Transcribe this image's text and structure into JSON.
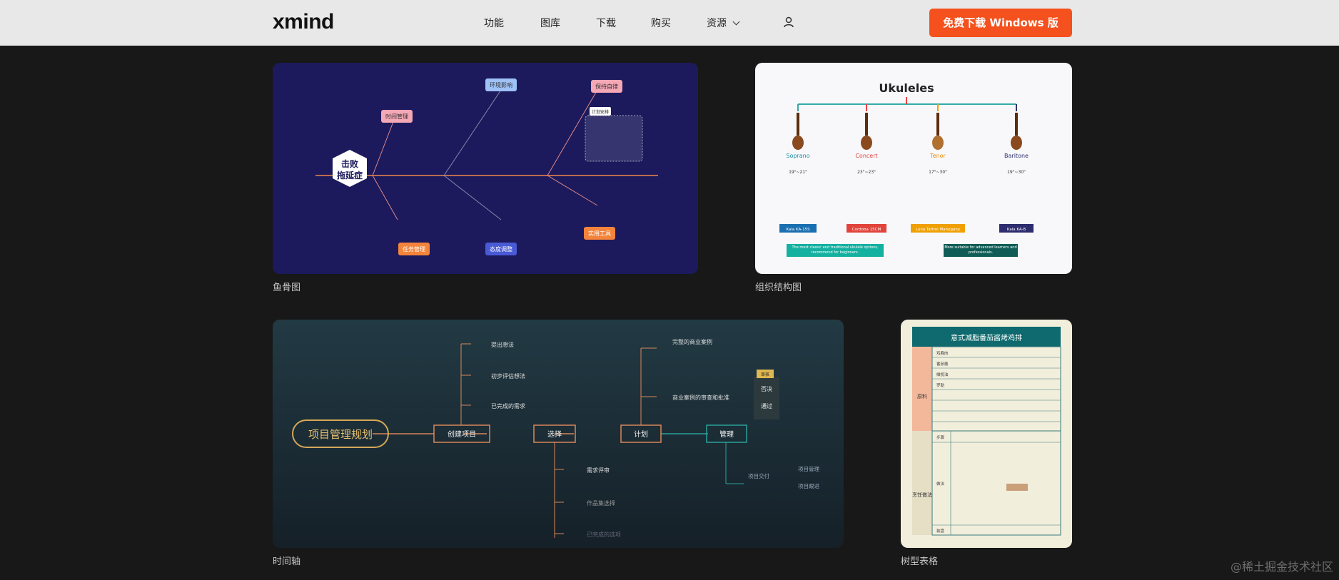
{
  "nav": {
    "logo": "xmind",
    "items": [
      "功能",
      "图库",
      "下载",
      "购买",
      "资源"
    ],
    "cta": "免费下载 Windows 版"
  },
  "cards": {
    "fishbone": {
      "caption": "鱼骨图",
      "head": [
        "击败",
        "拖延症"
      ],
      "categories": [
        "时间管理",
        "环境影响",
        "保持自律",
        "任务管理",
        "态度调整",
        "实用工具"
      ],
      "sub_label": "计划安排"
    },
    "org": {
      "caption": "组织结构图",
      "title": "Ukuleles",
      "types": [
        "Soprano",
        "Concert",
        "Tenor",
        "Baritone"
      ],
      "sizes": [
        "19\"~21\"",
        "23\"~23\"",
        "17\"~30\"",
        "19\"~30\""
      ],
      "models": [
        "Kala KA-15S",
        "Cordoba 15CM",
        "Luna Tattoo Mahogany",
        "Kala KA-B"
      ],
      "footer": [
        "The most classic and traditional ukulele options, recommend for beginners.",
        "More suitable for advanced learners and professionals."
      ]
    },
    "timeline": {
      "caption": "时间轴",
      "root": "项目管理规划",
      "stages": [
        "创建项目",
        "选择",
        "计划",
        "管理"
      ],
      "top_left": [
        "提出想法",
        "初步评估想法",
        "已完成的需求"
      ],
      "bottom_left": [
        "需求评审",
        "作品集选择",
        "已完成的选项"
      ],
      "top_right": [
        "完整的商业案例",
        "商业案例的审查和批准"
      ],
      "decision": [
        "审核",
        "否决",
        "通过"
      ],
      "delivery": "项目交付",
      "delivery_items": [
        "项目管理",
        "项目跟进"
      ]
    },
    "tree": {
      "caption": "树型表格",
      "title": "意式减脂番茄酱烤鸡排",
      "side": [
        "原料",
        "烹饪做法"
      ],
      "rows": [
        "鸡胸肉",
        "番茄酱",
        "橄榄油",
        "罗勒"
      ],
      "sub": [
        "步骤",
        "做法",
        "装盘"
      ]
    }
  },
  "watermark": "@稀土掘金技术社区",
  "colors": {
    "accent": "#f4511e",
    "nav_bg": "#e8e8e8",
    "page_bg": "#181818"
  }
}
